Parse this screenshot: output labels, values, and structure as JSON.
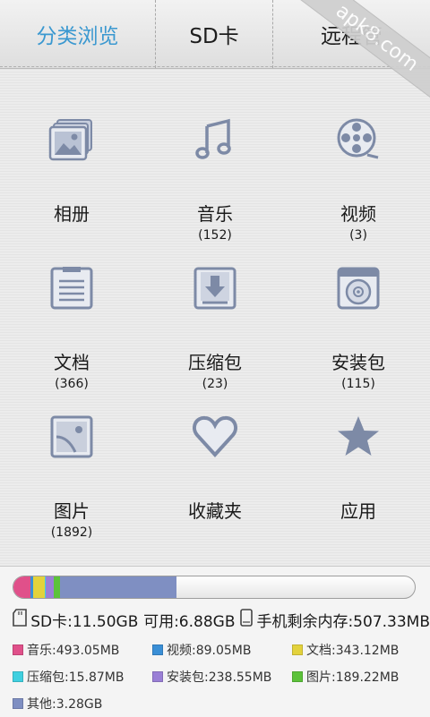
{
  "tabs": [
    {
      "label": "分类浏览",
      "active": true
    },
    {
      "label": "SD卡",
      "active": false
    },
    {
      "label": "远程管",
      "active": false
    }
  ],
  "watermark": "apk8.com",
  "categories": [
    {
      "label": "相册",
      "count": "",
      "icon": "photo-album-icon"
    },
    {
      "label": "音乐",
      "count": "(152)",
      "icon": "music-note-icon"
    },
    {
      "label": "视频",
      "count": "(3)",
      "icon": "film-reel-icon"
    },
    {
      "label": "文档",
      "count": "(366)",
      "icon": "document-icon"
    },
    {
      "label": "压缩包",
      "count": "(23)",
      "icon": "archive-download-icon"
    },
    {
      "label": "安装包",
      "count": "(115)",
      "icon": "package-disc-icon"
    },
    {
      "label": "图片",
      "count": "(1892)",
      "icon": "picture-icon"
    },
    {
      "label": "收藏夹",
      "count": "",
      "icon": "heart-icon"
    },
    {
      "label": "应用",
      "count": "",
      "icon": "star-icon"
    }
  ],
  "storage": {
    "sd_text": "SD卡:11.50GB",
    "available_text": "可用:6.88GB",
    "phone_text": "手机剩余内存:507.33MB",
    "usage_fraction_segments": [
      {
        "name": "音乐",
        "fraction": 0.042,
        "color": "#e0508a"
      },
      {
        "name": "视频",
        "fraction": 0.008,
        "color": "#3a8fd6"
      },
      {
        "name": "文档",
        "fraction": 0.029,
        "color": "#e3d23c"
      },
      {
        "name": "压缩包",
        "fraction": 0.002,
        "color": "#40d0e0"
      },
      {
        "name": "安装包",
        "fraction": 0.02,
        "color": "#9a7fd6"
      },
      {
        "name": "图片",
        "fraction": 0.016,
        "color": "#5cc23a"
      },
      {
        "name": "其他",
        "fraction": 0.29,
        "color": "#7f8fc2"
      }
    ],
    "legend": [
      {
        "label": "音乐:493.05MB",
        "color": "#e0508a"
      },
      {
        "label": "视频:89.05MB",
        "color": "#3a8fd6"
      },
      {
        "label": "文档:343.12MB",
        "color": "#e3d23c"
      },
      {
        "label": "压缩包:15.87MB",
        "color": "#40d0e0"
      },
      {
        "label": "安装包:238.55MB",
        "color": "#9a7fd6"
      },
      {
        "label": "图片:189.22MB",
        "color": "#5cc23a"
      },
      {
        "label": "其他:3.28GB",
        "color": "#7f8fc2"
      }
    ]
  },
  "colors": {
    "accent": "#3a98d0",
    "icon": "#7d8aa6"
  }
}
